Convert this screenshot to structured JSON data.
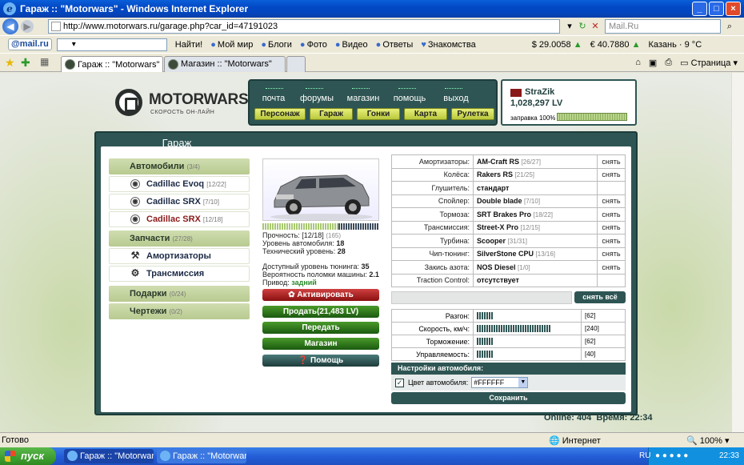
{
  "window": {
    "title": "Гараж :: \"Motorwars\" - Windows Internet Explorer"
  },
  "browser": {
    "address": "http://www.motorwars.ru/garage.php?car_id=47191023",
    "search_placeholder": "Mail.Ru",
    "search_button": "Найти!",
    "mailru_label": "@mail.ru",
    "toolbar_links": [
      "Мой мир",
      "Блоги",
      "Фото",
      "Видео",
      "Ответы",
      "Знакомства"
    ],
    "usd": "$ 29.0058",
    "eur": "€ 40.7880",
    "weather": "Казань · 9 °C",
    "tabs": [
      {
        "label": "Гараж :: \"Motorwars\""
      },
      {
        "label": "Магазин :: \"Motorwars\""
      }
    ],
    "page_menu": "Страница"
  },
  "site": {
    "logo_text": "MOTORWARS.RU",
    "logo_sub": "СКОРОСТЬ ОН-ЛАЙН",
    "nav": [
      "почта",
      "форумы",
      "магазин",
      "помощь",
      "выход"
    ],
    "subnav": [
      "Персонаж",
      "Гараж",
      "Гонки",
      "Карта",
      "Рулетка"
    ],
    "user": {
      "name": "StraZik",
      "money": "1,028,297 LV",
      "fuel_label": "заправка 100%",
      "fuel_fraction": 1.0
    }
  },
  "garage": {
    "title": "Гараж",
    "sections": {
      "cars_label": "Автомобили",
      "cars_count": "(3/4)",
      "cars": [
        {
          "name": "Cadillac Evoq",
          "count": "[12/22]"
        },
        {
          "name": "Cadillac SRX",
          "count": "[7/10]"
        },
        {
          "name": "Cadillac SRX",
          "count": "[12/18]"
        }
      ],
      "parts_label": "Запчасти",
      "parts_count": "(27/28)",
      "parts": [
        {
          "name": "Амортизаторы"
        },
        {
          "name": "Трансмиссия"
        }
      ],
      "gifts_label": "Подарки",
      "gifts_count": "(0/24)",
      "drawings_label": "Чертежи",
      "drawings_count": "(0/2)"
    },
    "car": {
      "durability_label": "Прочность:",
      "durability_value": "[12/18]",
      "durability_extra": "(165)",
      "durability_fraction": 0.67,
      "level_label": "Уровень автомобиля:",
      "level_value": "18",
      "tech_label": "Технический уровень:",
      "tech_value": "28",
      "tuning_label": "Доступный уровень тюнинга:",
      "tuning_value": "35",
      "break_label": "Вероятность поломки машины:",
      "break_value": "2.1",
      "drive_label": "Привод:",
      "drive_value": "задний"
    },
    "actions": {
      "activate": "Активировать",
      "sell": "Продать(21,483 LV)",
      "transfer": "Передать",
      "shop": "Магазин",
      "help": "Помощь"
    },
    "parts_table": [
      {
        "label": "Амортизаторы:",
        "value": "AM-Craft RS",
        "extra": "[26/27]",
        "action": "снять"
      },
      {
        "label": "Колёса:",
        "value": "Rakers RS",
        "extra": "[21/25]",
        "action": "снять"
      },
      {
        "label": "Глушитель:",
        "value": "стандарт",
        "extra": "",
        "action": ""
      },
      {
        "label": "Спойлер:",
        "value": "Double blade",
        "extra": "[7/10]",
        "action": "снять"
      },
      {
        "label": "Тормоза:",
        "value": "SRT Brakes Pro",
        "extra": "[18/22]",
        "action": "снять"
      },
      {
        "label": "Трансмиссия:",
        "value": "Street-X Pro",
        "extra": "[12/15]",
        "action": "снять"
      },
      {
        "label": "Турбина:",
        "value": "Scooper",
        "extra": "[31/31]",
        "action": "снять"
      },
      {
        "label": "Чип-тюнинг:",
        "value": "SilverStone CPU",
        "extra": "[13/16]",
        "action": "снять"
      },
      {
        "label": "Закись азота:",
        "value": "NOS Diesel",
        "extra": "[1/0]",
        "action": "снять"
      },
      {
        "label": "Traction Control:",
        "value": "отсутствует",
        "extra": "",
        "action": ""
      }
    ],
    "remove_all": "снять всё",
    "specs": [
      {
        "label": "Разгон:",
        "value": "[62]",
        "level": 62
      },
      {
        "label": "Скорость, км/ч:",
        "value": "[240]",
        "level": 240
      },
      {
        "label": "Торможение:",
        "value": "[62]",
        "level": 62
      },
      {
        "label": "Управляемость:",
        "value": "[40]",
        "level": 40
      }
    ],
    "settings_title": "Настройки автомобиля:",
    "color_label": "Цвет автомобиля:",
    "color_value": "#FFFFFF",
    "save": "Сохранить"
  },
  "footer": {
    "online": "Online: 404",
    "time": "Время: 22:34"
  },
  "status": {
    "left": "Готово",
    "zone": "Интернет",
    "zoom": "100%"
  },
  "taskbar": {
    "start": "пуск",
    "tasks": [
      "Гараж :: \"Motorwars...",
      "Гараж :: \"Motorwars..."
    ],
    "lang": "RU",
    "clock": "22:33"
  }
}
